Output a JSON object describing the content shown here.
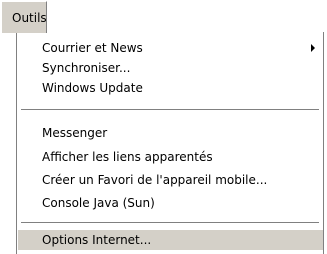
{
  "menubar": {
    "active_menu": "Outils"
  },
  "menu": {
    "group1": [
      {
        "label": "Courrier et News",
        "has_submenu": true
      },
      {
        "label": "Synchroniser..."
      },
      {
        "label": "Windows Update"
      }
    ],
    "group2": [
      {
        "label": "Messenger"
      },
      {
        "label": "Afficher les liens apparentés"
      },
      {
        "label": "Créer un Favori de l'appareil mobile..."
      },
      {
        "label": "Console Java (Sun)"
      }
    ],
    "group3": [
      {
        "label": "Options Internet...",
        "highlighted": true
      }
    ]
  },
  "colors": {
    "menu_highlight": "#d4d0c8",
    "separator": "#808080"
  }
}
